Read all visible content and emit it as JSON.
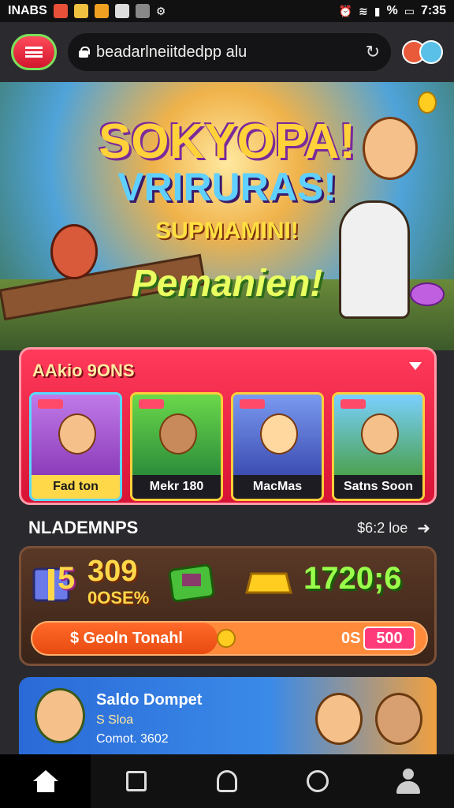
{
  "status_bar": {
    "left_text": "INABS",
    "right_text": "%",
    "time": "7:35",
    "app_icons": [
      {
        "name": "app-icon-mail",
        "color": "#e8503a"
      },
      {
        "name": "app-icon-chat",
        "color": "#f0c040"
      },
      {
        "name": "app-icon-d",
        "color": "#f0a020"
      },
      {
        "name": "app-icon-photo",
        "color": "#dddddd"
      },
      {
        "name": "app-icon-camera",
        "color": "#aaaaaa"
      }
    ]
  },
  "browser": {
    "url": "beadarlneiitdedpp alu",
    "reload_icon": "↻"
  },
  "hero": {
    "title_1": "SOKYOPA!",
    "title_2": "VRIRURAS!",
    "title_3": "SUPMAMINI!",
    "title_4": "Pemanien!"
  },
  "games": {
    "title": "AAkio 9ONS",
    "cards": [
      {
        "label": "Fad ton",
        "bg": "#b06ad8"
      },
      {
        "label": "Mekr 180",
        "bg": "#4ac06a"
      },
      {
        "label": "MacMas",
        "bg": "#5a7ae0"
      },
      {
        "label": "Satns Soon",
        "bg": "#5ab0f0"
      }
    ]
  },
  "section": {
    "title": "NLADEMNPS",
    "link": "$6:2 loe"
  },
  "wallet": {
    "gift_number": "5",
    "big_number": "309",
    "small_number": "0OSE%",
    "balance": "1720;6",
    "progress_label": "$ Geoln Tonahl",
    "progress_unit": "0S",
    "progress_value": "500",
    "progress_fraction": 0.47
  },
  "promo": {
    "title": "Saldo Dompet",
    "line_2": "S Sloa",
    "line_3": "Comot. 3602"
  },
  "colors": {
    "accent_red": "#e8203e",
    "accent_yellow": "#ffd84a",
    "accent_green": "#9aff4a"
  }
}
